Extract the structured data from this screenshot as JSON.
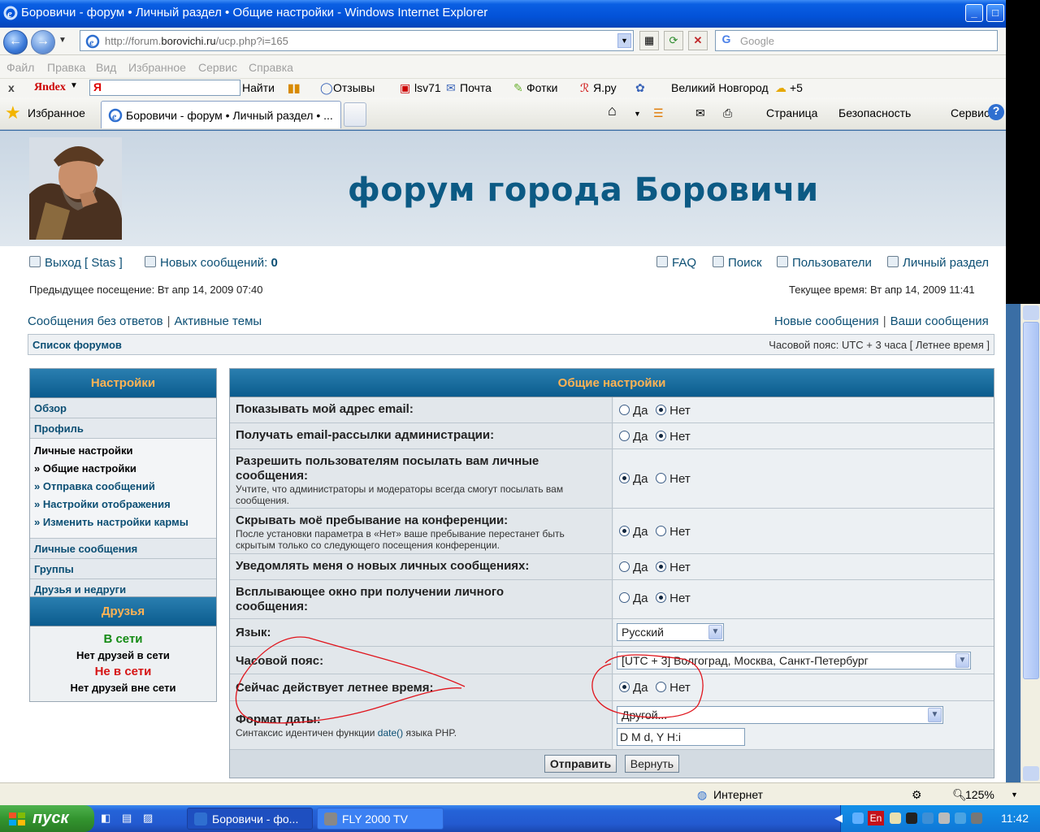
{
  "window": {
    "title": "Боровичи - форум • Личный раздел • Общие настройки - Windows Internet Explorer",
    "address_prefix": "http://forum.",
    "address_domain": "borovichi.ru",
    "address_path": "/ucp.php?i=165",
    "search_placeholder": "Google"
  },
  "menu": [
    "Файл",
    "Правка",
    "Вид",
    "Избранное",
    "Сервис",
    "Справка"
  ],
  "yandex_bar": {
    "close": "x",
    "logo": "Яndex",
    "input_value": "Я",
    "find": "Найти",
    "reviews": "Отзывы",
    "user": "lsv71",
    "mail": "Почта",
    "photos": "Фотки",
    "yaru": "Я.ру",
    "city": "Великий Новгород",
    "weather": "+5"
  },
  "tabs": {
    "favorites": "Избранное",
    "active_tab": "Боровичи - форум • Личный раздел • ...",
    "page_menu": "Страница",
    "safety_menu": "Безопасность",
    "tools_menu": "Сервис"
  },
  "forum": {
    "site_title": "форум города Боровичи",
    "logout": "Выход [ Stas ]",
    "new_messages_label": "Новых сообщений:",
    "new_messages_count": "0",
    "faq": "FAQ",
    "search": "Поиск",
    "users": "Пользователи",
    "ucp": "Личный раздел",
    "last_visit": "Предыдущее посещение: Вт апр 14, 2009 07:40",
    "current_time": "Текущее время: Вт апр 14, 2009 11:41",
    "unanswered": "Сообщения без ответов",
    "active_topics": "Активные темы",
    "new_posts": "Новые сообщения",
    "your_posts": "Ваши сообщения",
    "separator": "|",
    "forum_index": "Список форумов",
    "timezone": "Часовой пояс: UTC + 3 часа [ Летнее время ]"
  },
  "sidebar": {
    "settings_title": "Настройки",
    "items": [
      "Обзор",
      "Профиль"
    ],
    "personal_title": "Личные настройки",
    "personal_sub": [
      "» Общие настройки",
      "» Отправка сообщений",
      "» Настройки отображения",
      "» Изменить настройки кармы"
    ],
    "items2": [
      "Личные сообщения",
      "Группы",
      "Друзья и недруги"
    ],
    "friends_title": "Друзья",
    "online": "В сети",
    "no_online": "Нет друзей в сети",
    "offline": "Не в сети",
    "no_offline": "Нет друзей вне сети"
  },
  "panel": {
    "title": "Общие настройки",
    "yes": "Да",
    "no": "Нет",
    "rows": [
      {
        "q": "Показывать мой адрес email:",
        "selected": "no"
      },
      {
        "q": "Получать email-рассылки администрации:",
        "selected": "no"
      },
      {
        "q": "Разрешить пользователям посылать вам личные сообщения:",
        "d": "Учтите, что администраторы и модераторы всегда смогут посылать вам сообщения.",
        "selected": "yes"
      },
      {
        "q": "Скрывать моё пребывание на конференции:",
        "d": "После установки параметра в «Нет» ваше пребывание перестанет быть скрытым только со следующего посещения конференции.",
        "selected": "yes"
      },
      {
        "q": "Уведомлять меня о новых личных сообщениях:",
        "selected": "no"
      },
      {
        "q": "Всплывающее окно при получении личного сообщения:",
        "selected": "no"
      }
    ],
    "language_label": "Язык:",
    "language_value": "Русский",
    "tz_label": "Часовой пояс:",
    "tz_value": "[UTC + 3] Волгоград, Москва, Санкт-Петербург",
    "dst_label": "Сейчас действует летнее время:",
    "dst_selected": "yes",
    "date_label": "Формат даты:",
    "date_desc_prefix": "Синтаксис идентичен функции",
    "date_desc_link": "date()",
    "date_desc_suffix": "языка PHP.",
    "date_select": "Другой...",
    "date_value": "D M d, Y H:i",
    "submit": "Отправить",
    "reset": "Вернуть"
  },
  "statusbar": {
    "zone": "Интернет",
    "zoom": "125%"
  },
  "taskbar": {
    "start": "пуск",
    "task1": "Боровичи - фо...",
    "task2": "FLY 2000 TV",
    "lang": "En",
    "clock": "11:42"
  },
  "colors": {
    "header_gradient": "#2a7fb0",
    "accent_orange": "#ffb354",
    "link_blue": "#0c4f74",
    "title_blue": "#0c5a84",
    "annotation_red": "#e0141c"
  }
}
